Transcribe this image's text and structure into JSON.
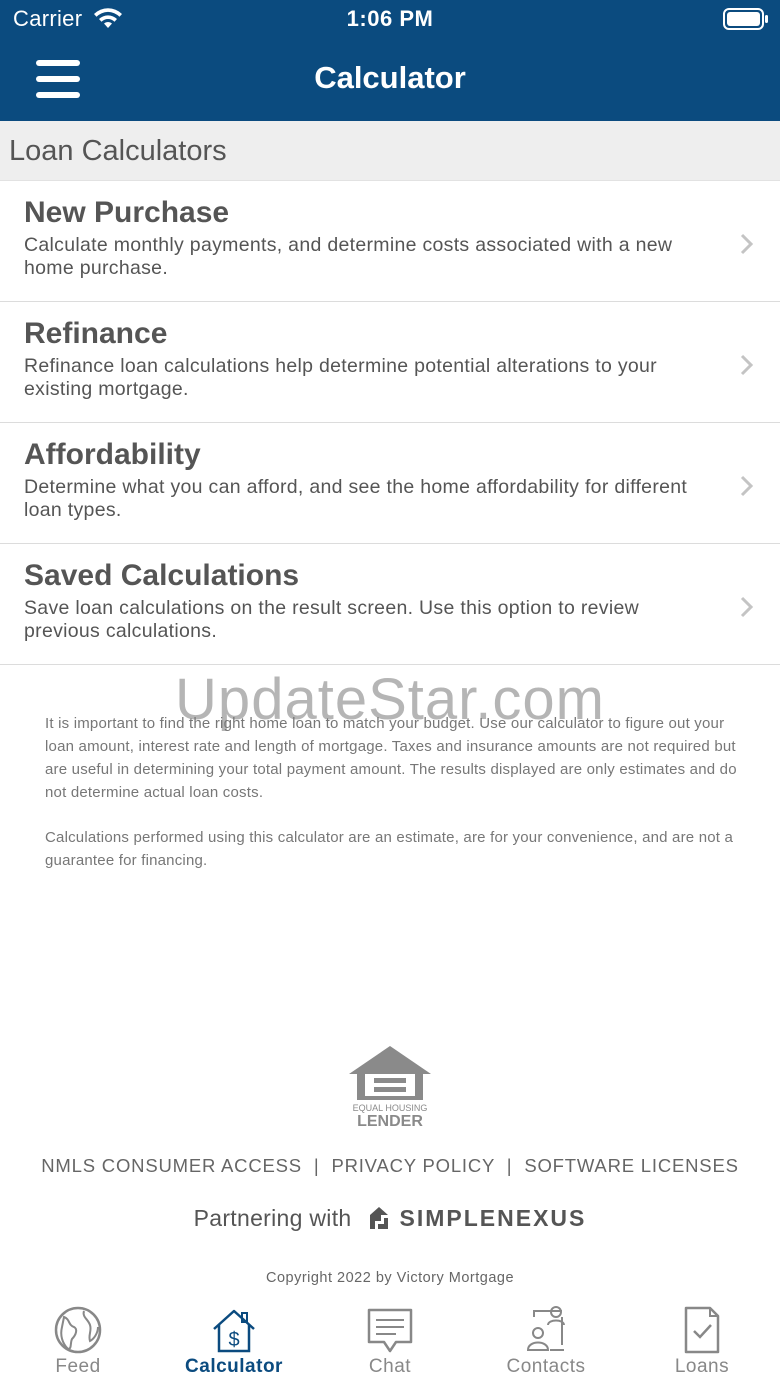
{
  "status_bar": {
    "carrier": "Carrier",
    "time": "1:06 PM"
  },
  "nav": {
    "title": "Calculator"
  },
  "section": {
    "title": "Loan Calculators"
  },
  "calculators": [
    {
      "title": "New Purchase",
      "description": "Calculate monthly payments, and determine costs associated with a new home purchase."
    },
    {
      "title": "Refinance",
      "description": "Refinance loan calculations help determine potential alterations to your existing mortgage."
    },
    {
      "title": "Affordability",
      "description": "Determine what you can afford, and see the home affordability for different loan types."
    },
    {
      "title": "Saved Calculations",
      "description": "Save loan calculations on the result screen. Use this option to review previous calculations."
    }
  ],
  "disclaimer": {
    "paragraph1": "It is important to find the right home loan to match your budget. Use our calculator to figure out your loan amount, interest rate and length of mortgage. Taxes and insurance amounts are not required but are useful in determining your total payment amount. The results displayed are only estimates and do not determine actual loan costs.",
    "paragraph2": "Calculations performed using this calculator are an estimate, are for your convenience, and are not a guarantee for financing."
  },
  "watermark": "UpdateStar.com",
  "footer": {
    "ehl_line1": "EQUAL HOUSING",
    "ehl_line2": "LENDER",
    "links": [
      "NMLS CONSUMER ACCESS",
      "PRIVACY POLICY",
      "SOFTWARE LICENSES"
    ],
    "separator": "|",
    "partner_label": "Partnering with",
    "partner_name": "SIMPLENEXUS",
    "copyright": "Copyright 2022 by Victory Mortgage"
  },
  "tabs": [
    {
      "label": "Feed",
      "icon": "globe-icon"
    },
    {
      "label": "Calculator",
      "icon": "house-dollar-icon",
      "active": true
    },
    {
      "label": "Chat",
      "icon": "chat-bubble-icon"
    },
    {
      "label": "Contacts",
      "icon": "contacts-icon"
    },
    {
      "label": "Loans",
      "icon": "document-check-icon"
    }
  ],
  "colors": {
    "primary": "#0b4b7f",
    "section_bg": "#eeeeee",
    "text_gray": "#555555",
    "tab_inactive": "#888888"
  }
}
